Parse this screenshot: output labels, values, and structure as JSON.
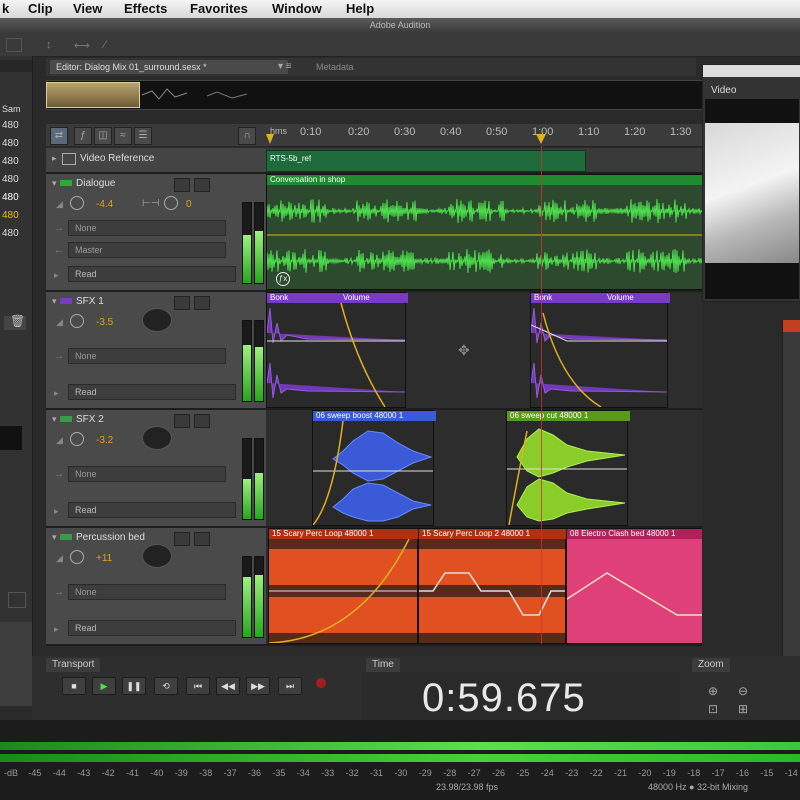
{
  "menu": [
    "k",
    "Clip",
    "View",
    "Effects",
    "Favorites",
    "Window",
    "Help"
  ],
  "window_title": "Adobe Audition",
  "left_panel": {
    "header": "Sam",
    "numbers": [
      "480",
      "480",
      "480",
      "480",
      "480",
      "480",
      "480"
    ]
  },
  "editor": {
    "tab_label": "Editor: Dialog Mix 01_surround.sesx *",
    "metadata_tab": "Metadata"
  },
  "ruler": {
    "ticks": [
      "hms",
      "0:10",
      "0:20",
      "0:30",
      "0:40",
      "0:50",
      "1:00",
      "1:10",
      "1:20",
      "1:30"
    ]
  },
  "video_reference": {
    "name": "Video Reference",
    "clip": "RTS-5b_ref"
  },
  "tracks": [
    {
      "name": "Dialogue",
      "volume": "-4.4",
      "pan": "0",
      "input": "None",
      "output": "Master",
      "mode": "Read",
      "clips": [
        {
          "title": "Conversation in shop"
        }
      ]
    },
    {
      "name": "SFX 1",
      "volume": "-3.5",
      "input": "None",
      "mode": "Read",
      "clips": [
        {
          "title": "Bonk",
          "env": "Volume"
        },
        {
          "title": "Bonk",
          "env": "Volume"
        }
      ]
    },
    {
      "name": "SFX 2",
      "volume": "-3.2",
      "input": "None",
      "mode": "Read",
      "clips": [
        {
          "title": "06 sweep boost 48000 1"
        },
        {
          "title": "06 sweep cut 48000 1"
        }
      ]
    },
    {
      "name": "Percussion bed",
      "volume": "+11",
      "input": "None",
      "mode": "Read",
      "clips": [
        {
          "title": "15 Scary Perc Loop 48000 1"
        },
        {
          "title": "15 Scary Perc Loop 2 48000 1"
        },
        {
          "title": "08 Electro Clash bed 48000 1"
        }
      ]
    }
  ],
  "video_panel": {
    "title": "Video"
  },
  "transport": {
    "title": "Transport"
  },
  "time_panel": {
    "title": "Time",
    "value": "0:59.675"
  },
  "zoom_panel": {
    "title": "Zoom"
  },
  "level_meter": {
    "labels": [
      "-dB",
      "-45",
      "-44",
      "-43",
      "-42",
      "-41",
      "-40",
      "-39",
      "-38",
      "-37",
      "-36",
      "-35",
      "-34",
      "-33",
      "-32",
      "-31",
      "-30",
      "-29",
      "-28",
      "-27",
      "-26",
      "-25",
      "-24",
      "-23",
      "-22",
      "-21",
      "-20",
      "-19",
      "-18",
      "-17",
      "-16",
      "-15",
      "-14"
    ]
  },
  "status": {
    "fps": "23.98/23.98 fps",
    "format": "48000 Hz ● 32-bit Mixing"
  },
  "colors": {
    "accent": "#2fa83a",
    "envelope": "#e0b020",
    "playhead": "#d03030",
    "sfx1": "#7a3ac8",
    "sfx2_a": "#3a5ad8",
    "sfx2_b": "#8acc2a",
    "perc_a": "#e05020",
    "perc_b": "#e0407a"
  }
}
